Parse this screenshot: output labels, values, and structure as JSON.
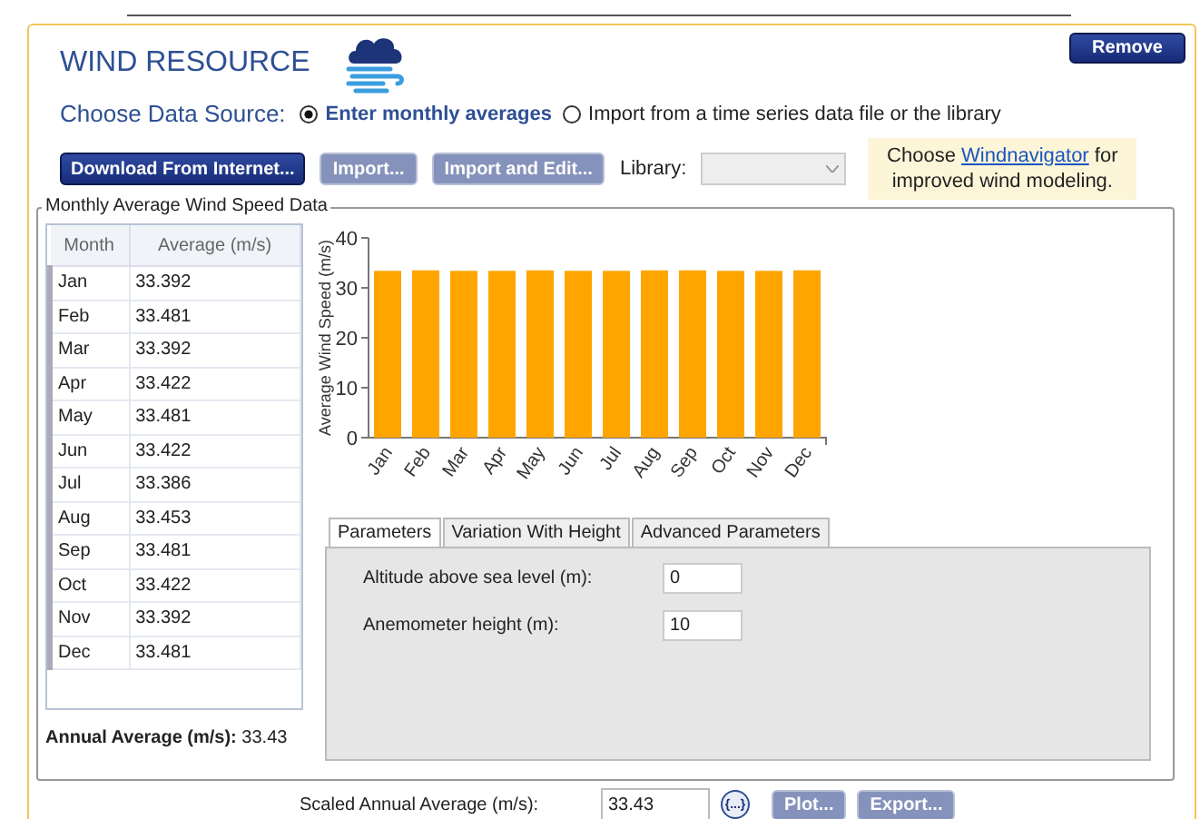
{
  "module": {
    "title": "WIND RESOURCE",
    "remove_button": "Remove"
  },
  "data_source": {
    "label": "Choose Data Source:",
    "options": [
      {
        "label": "Enter monthly averages",
        "selected": true
      },
      {
        "label": "Import from a time series data file or the library",
        "selected": false
      }
    ]
  },
  "toolbar": {
    "buttons": [
      {
        "label": "Download From Internet...",
        "disabled": false
      },
      {
        "label": "Import...",
        "disabled": true
      },
      {
        "label": "Import and Edit...",
        "disabled": true
      }
    ],
    "library_label": "Library:",
    "info": {
      "before": "Choose ",
      "link": "Windnavigator",
      "after": " for improved wind modeling."
    }
  },
  "group": {
    "title": "Monthly Average Wind Speed Data",
    "table": {
      "columns": [
        "Month",
        "Average (m/s)"
      ],
      "rows": [
        [
          "Jan",
          "33.392"
        ],
        [
          "Feb",
          "33.481"
        ],
        [
          "Mar",
          "33.392"
        ],
        [
          "Apr",
          "33.422"
        ],
        [
          "May",
          "33.481"
        ],
        [
          "Jun",
          "33.422"
        ],
        [
          "Jul",
          "33.386"
        ],
        [
          "Aug",
          "33.453"
        ],
        [
          "Sep",
          "33.481"
        ],
        [
          "Oct",
          "33.422"
        ],
        [
          "Nov",
          "33.392"
        ],
        [
          "Dec",
          "33.481"
        ]
      ]
    },
    "annual": {
      "label": "Annual Average (m/s):",
      "value": "33.43"
    },
    "chart_data": {
      "type": "bar",
      "ylabel": "Average Wind Speed (m/s)",
      "categories": [
        "Jan",
        "Feb",
        "Mar",
        "Apr",
        "May",
        "Jun",
        "Jul",
        "Aug",
        "Sep",
        "Oct",
        "Nov",
        "Dec"
      ],
      "series": [
        {
          "color": "#ffa500",
          "values": [
            33.4,
            33.5,
            33.4,
            33.4,
            33.5,
            33.4,
            33.4,
            33.5,
            33.5,
            33.4,
            33.4,
            33.5
          ]
        }
      ],
      "ylim": [
        0,
        40
      ],
      "yticks": [
        0,
        10,
        20,
        30,
        40
      ]
    },
    "tabs": [
      {
        "label": "Parameters",
        "selected": true
      },
      {
        "label": "Variation With Height",
        "selected": false
      },
      {
        "label": "Advanced Parameters",
        "selected": false
      }
    ],
    "fields": [
      {
        "label": "Altitude above sea level (m):",
        "value": "0"
      },
      {
        "label": "Anemometer height (m):",
        "value": "10"
      }
    ]
  },
  "bottom": {
    "label": "Scaled Annual Average (m/s):",
    "value": "33.43",
    "sensitivity_button": "{...}",
    "buttons": [
      {
        "label": "Plot...",
        "disabled": true
      },
      {
        "label": "Export...",
        "disabled": true
      }
    ]
  }
}
